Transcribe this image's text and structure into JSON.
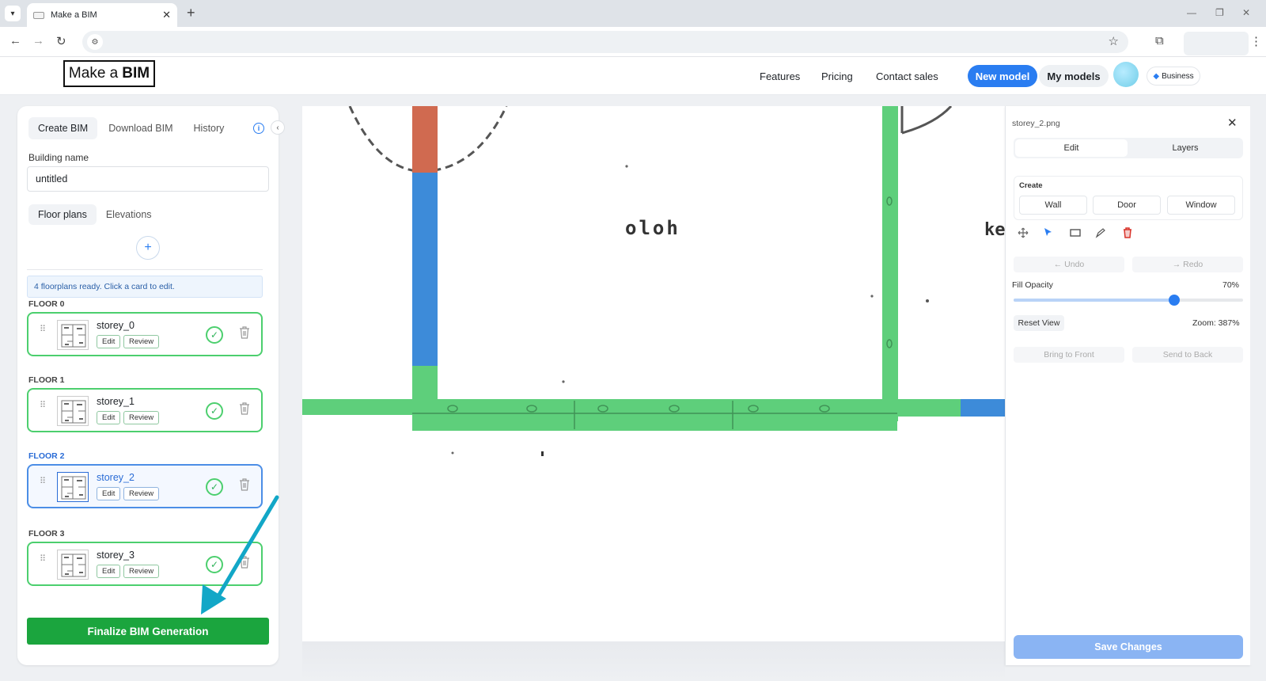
{
  "browser": {
    "tab_title": "Make a BIM",
    "icons": {
      "tab_list": "chevron-down-icon",
      "tab_close": "close-icon",
      "new_tab": "plus-icon",
      "back": "back-arrow-icon",
      "forward": "forward-arrow-icon",
      "reload": "reload-icon",
      "site_settings": "tune-icon",
      "bookmark": "star-icon",
      "extensions": "puzzle-icon",
      "menu": "kebab-icon"
    }
  },
  "header": {
    "logo_prefix": "Make a",
    "logo_bold": "BIM",
    "nav": [
      "Features",
      "Pricing",
      "Contact sales"
    ],
    "new_model": "New model",
    "my_models": "My models",
    "plan_badge": "Business"
  },
  "left_panel": {
    "tabs": [
      "Create BIM",
      "Download BIM",
      "History"
    ],
    "active_tab": 0,
    "building_name_label": "Building name",
    "building_name_value": "untitled",
    "subtabs": [
      "Floor plans",
      "Elevations"
    ],
    "notice": "4 floorplans ready. Click a card to edit.",
    "floors": [
      {
        "label": "FLOOR 0",
        "name": "storey_0",
        "edit": "Edit",
        "review": "Review",
        "selected": false
      },
      {
        "label": "FLOOR 1",
        "name": "storey_1",
        "edit": "Edit",
        "review": "Review",
        "selected": false
      },
      {
        "label": "FLOOR 2",
        "name": "storey_2",
        "edit": "Edit",
        "review": "Review",
        "selected": true
      },
      {
        "label": "FLOOR 3",
        "name": "storey_3",
        "edit": "Edit",
        "review": "Review",
        "selected": false
      }
    ],
    "finalize": "Finalize BIM Generation"
  },
  "canvas": {
    "room_label": "oloh",
    "edge_label": "ke",
    "colors": {
      "wall": "#5ecf7b",
      "door": "#3d8bd9",
      "window": "#d06a50"
    }
  },
  "right_panel": {
    "file_name": "storey_2.png",
    "tabs": [
      "Edit",
      "Layers"
    ],
    "create_label": "Create",
    "create_buttons": [
      "Wall",
      "Door",
      "Window"
    ],
    "tools": [
      "move-icon",
      "pointer-icon",
      "rectangle-icon",
      "pencil-icon",
      "delete-icon"
    ],
    "undo": "← Undo",
    "redo": "→ Redo",
    "fill_opacity_label": "Fill Opacity",
    "fill_opacity_value": "70%",
    "fill_opacity_fraction": 0.7,
    "reset_view": "Reset View",
    "zoom": "Zoom: 387%",
    "bring_front": "Bring to Front",
    "send_back": "Send to Back",
    "save": "Save Changes"
  },
  "colors": {
    "accent": "#2a7df1",
    "success": "#1ba53e",
    "selected_card": "#4c8ee6",
    "annotation_arrow": "#12a7c7"
  }
}
